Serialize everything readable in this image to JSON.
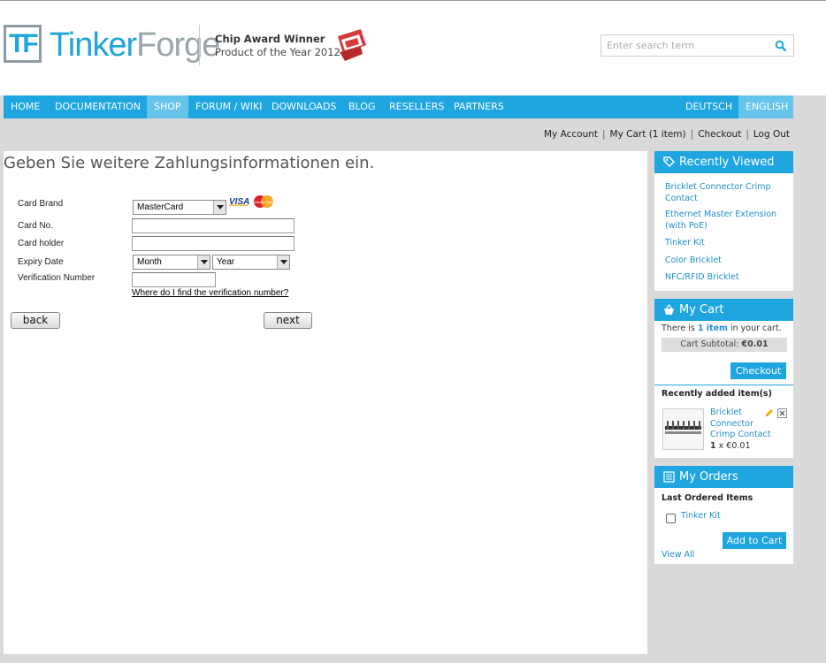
{
  "brand": {
    "logo_mark": "TF",
    "name_part1": "Tinker",
    "name_part2": "Forge"
  },
  "award": {
    "title": "Chip Award Winner",
    "subtitle": "Product of the Year 2012"
  },
  "search": {
    "placeholder": "Enter search term",
    "icon": "search-icon"
  },
  "nav": {
    "items": [
      "HOME",
      "DOCUMENTATION",
      "SHOP",
      "FORUM / WIKI",
      "DOWNLOADS",
      "BLOG",
      "RESELLERS",
      "PARTNERS"
    ],
    "active": "SHOP",
    "languages": [
      "DEUTSCH",
      "ENGLISH"
    ],
    "active_language": "ENGLISH"
  },
  "toplinks": [
    "My Account",
    "My Cart (1 item)",
    "Checkout",
    "Log Out"
  ],
  "page": {
    "title": "Geben Sie weitere Zahlungsinformationen ein."
  },
  "payment_form": {
    "card_brand_label": "Card Brand",
    "card_brand_value": "MasterCard",
    "card_no_label": "Card No.",
    "card_holder_label": "Card holder",
    "expiry_label": "Expiry Date",
    "month_value": "Month",
    "year_value": "Year",
    "verification_label": "Verification Number",
    "verification_help": "Where do I find the verification number?",
    "visa_logo": "VISA",
    "mastercard_logo": "MasterCard",
    "back_label": "back",
    "next_label": "next"
  },
  "recently_viewed": {
    "title": "Recently Viewed",
    "icon": "tag-icon",
    "items": [
      "Bricklet Connector Crimp Contact",
      "Ethernet Master Extension (with PoE)",
      "Tinker Kit",
      "Color Bricklet",
      "NFC/RFID Bricklet"
    ]
  },
  "cart": {
    "title": "My Cart",
    "icon": "basket-icon",
    "there_is": "There is",
    "count_text": "1 item",
    "in_cart": "in your cart.",
    "subtotal_label": "Cart Subtotal:",
    "subtotal_value": "€0.01",
    "checkout_label": "Checkout",
    "recently_added_label": "Recently added item(s)",
    "item": {
      "name": "Bricklet Connector Crimp Contact",
      "qty": "1",
      "price": "x €0.01"
    }
  },
  "orders": {
    "title": "My Orders",
    "icon": "list-icon",
    "subtitle": "Last Ordered Items",
    "items": [
      "Tinker Kit"
    ],
    "add_to_cart_label": "Add to Cart",
    "view_all_label": "View All"
  },
  "colors": {
    "accent": "#1fa5e0",
    "accent_light": "#66c3ea",
    "link": "#1f8fc4",
    "page_bg": "#d9d9d9"
  }
}
